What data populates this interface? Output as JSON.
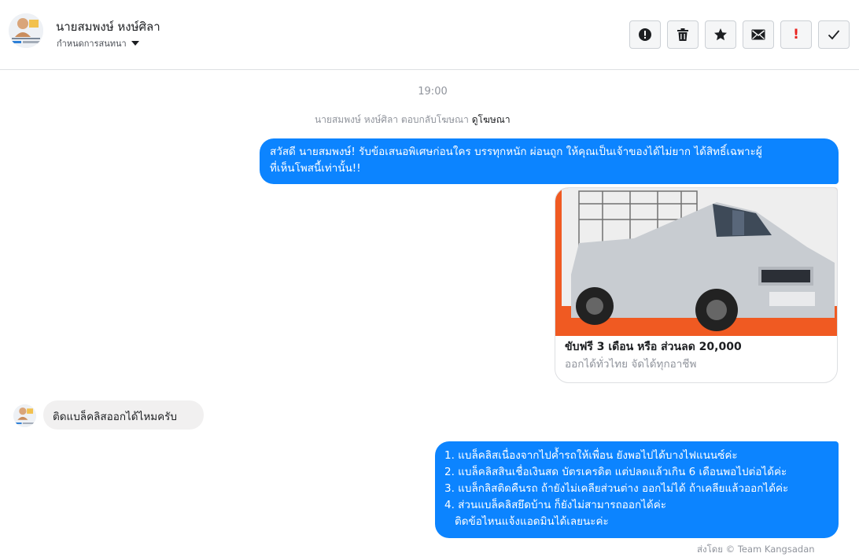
{
  "header": {
    "name": "นายสมพงษ์ หงษ์ศิลา",
    "subtitle": "กำหนดการสนทนา",
    "buttons": [
      {
        "name": "mark-spam",
        "icon": "alert-circle-icon"
      },
      {
        "name": "delete",
        "icon": "trash-icon"
      },
      {
        "name": "star",
        "icon": "star-icon"
      },
      {
        "name": "mark-unread",
        "icon": "envelope-icon"
      },
      {
        "name": "important",
        "icon": "exclamation-icon",
        "label": "!"
      },
      {
        "name": "done",
        "icon": "checkmark-icon"
      }
    ]
  },
  "conversation": {
    "timestamp": "19:00",
    "ad_reply_text": "นายสมพงษ์ หงษ์ศิลา ตอบกลับโฆษณา",
    "ad_reply_link": "ดูโฆษณา",
    "outgoing_intro": {
      "line1": "สวัสดี นายสมพงษ์! รับข้อเสนอพิเศษก่อนใคร บรรทุกหนัก ผ่อนถูก ให้คุณเป็นเจ้าของได้ไม่ยาก ได้สิทธิ์เฉพาะผู้",
      "line2": "ที่เห็นโพสนี้เท่านั้น!!"
    },
    "ad_card": {
      "title": "ขับฟรี 3 เดือน หรือ ส่วนลด 20,000",
      "subtitle": "ออกได้ทั่วไทย จัดได้ทุกอาชีพ",
      "image": "silver-pickup-truck-with-cage-rack"
    },
    "incoming_message": "ติดแบล็คลิสออกได้ไหมครับ",
    "reply_lines": [
      "1. แบล็คลิสเนื่องจากไปค้ำรถให้เพื่อน ยังพอไปได้บางไฟแนนซ์ค่ะ",
      "2. แบล็คลิสสินเชื่อเงินสด บัตรเครดิต แต่ปลดแล้วเกิน 6 เดือนพอไปต่อได้ค่ะ",
      "3. แบล็กลิสติดคืนรถ ถ้ายังไม่เคลียส่วนต่าง ออกไม่ได้ ถ้าเคลียแล้วออกได้ค่ะ",
      "4. ส่วนแบล็คลิสยึดบ้าน ก็ยังไม่สามารถออกได้ค่ะ",
      "ติดข้อไหนแจ้งแอดมินได้เลยนะค่ะ"
    ],
    "sent_by": "ส่งโดย © Team Kangsadan"
  },
  "colors": {
    "outgoing_bubble": "#0c84ff",
    "incoming_bubble": "#f1f0f0",
    "important_red": "#e8231f",
    "ad_banner_orange": "#f05a22"
  }
}
